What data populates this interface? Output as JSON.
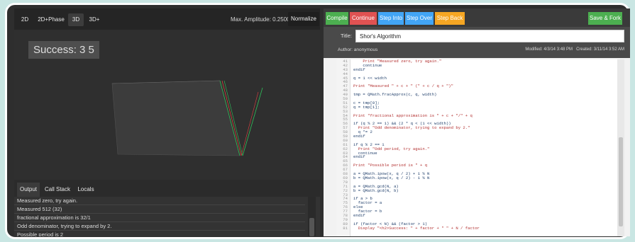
{
  "viz_tabs": [
    "2D",
    "2D+Phase",
    "3D",
    "3D+"
  ],
  "active_viz_tab": "3D",
  "max_amplitude": "Max. Amplitude: 0.250000",
  "normalize_label": "Normalize",
  "success_text": "Success: 3 5",
  "output_tabs": [
    "Output",
    "Call Stack",
    "Locals"
  ],
  "output_lines": [
    "Measured zero, try again.",
    "Measured 512 (32)",
    "fractional approximation is 32/1",
    "Odd denominator, trying to expand by 2.",
    "Possible period is 2"
  ],
  "toolbar": {
    "compile": "Compile",
    "continue": "Continue",
    "step_into": "Step Into",
    "step_over": "Step Over",
    "step_back": "Step Back",
    "save_fork": "Save & Fork"
  },
  "editor_header": {
    "title_label": "Title:",
    "title_value": "Shor's Algorithm",
    "author": "Author: anonymous",
    "modified": "Modified: 4/3/14 3:48 PM",
    "created": "Created: 3/11/14 3:52 AM"
  },
  "code_lines": [
    {
      "n": "41",
      "t": "    Print \"Measured zero, try again.\"",
      "s": true
    },
    {
      "n": "42",
      "t": "    continue",
      "s": false
    },
    {
      "n": "43",
      "t": "endif",
      "s": false
    },
    {
      "n": "44",
      "t": "",
      "s": false
    },
    {
      "n": "45",
      "t": "q = 1 << width",
      "s": false
    },
    {
      "n": "46",
      "t": "",
      "s": false
    },
    {
      "n": "47",
      "t": "Print \"Measured \" + c + \" (\" + c / q + \")\"",
      "s": true
    },
    {
      "n": "48",
      "t": "",
      "s": false
    },
    {
      "n": "49",
      "t": "tmp = QMath.fracApprox(c, q, width)",
      "s": false
    },
    {
      "n": "50",
      "t": "",
      "s": false
    },
    {
      "n": "51",
      "t": "c = tmp[0];",
      "s": false
    },
    {
      "n": "52",
      "t": "q = tmp[1];",
      "s": false
    },
    {
      "n": "53",
      "t": "",
      "s": false
    },
    {
      "n": "54",
      "t": "Print \"fractional approximation is \" + c + \"/\" + q",
      "s": true
    },
    {
      "n": "55",
      "t": "",
      "s": false
    },
    {
      "n": "56",
      "t": "if (q % 2 == 1) && (2 * q < (1 << width))",
      "s": false
    },
    {
      "n": "57",
      "t": "  Print \"Odd denominator, trying to expand by 2.\"",
      "s": true
    },
    {
      "n": "58",
      "t": "  q *= 2",
      "s": false
    },
    {
      "n": "59",
      "t": "endif",
      "s": false
    },
    {
      "n": "60",
      "t": "",
      "s": false
    },
    {
      "n": "61",
      "t": "if q % 2 == 1",
      "s": false
    },
    {
      "n": "62",
      "t": "  Print \"Odd period, try again.\"",
      "s": true
    },
    {
      "n": "63",
      "t": "  continue",
      "s": false
    },
    {
      "n": "64",
      "t": "endif",
      "s": false
    },
    {
      "n": "65",
      "t": "",
      "s": false
    },
    {
      "n": "66",
      "t": "Print \"Possible period is \" + q",
      "s": true
    },
    {
      "n": "67",
      "t": "",
      "s": false
    },
    {
      "n": "68",
      "t": "a = QMath.ipow(x, q / 2) + 1 % N",
      "s": false
    },
    {
      "n": "69",
      "t": "b = QMath.ipow(x, q / 2) - 1 % N",
      "s": false
    },
    {
      "n": "70",
      "t": "",
      "s": false
    },
    {
      "n": "71",
      "t": "a = QMath.gcd(N, a)",
      "s": false
    },
    {
      "n": "72",
      "t": "b = QMath.gcd(N, b)",
      "s": false
    },
    {
      "n": "73",
      "t": "",
      "s": false
    },
    {
      "n": "74",
      "t": "if a > b",
      "s": false
    },
    {
      "n": "75",
      "t": "  factor = a",
      "s": false
    },
    {
      "n": "76",
      "t": "else",
      "s": false
    },
    {
      "n": "77",
      "t": "  factor = b",
      "s": false
    },
    {
      "n": "78",
      "t": "endif",
      "s": false
    },
    {
      "n": "79",
      "t": "",
      "s": false
    },
    {
      "n": "80",
      "t": "if (factor < N) && (factor > 1)",
      "s": false
    },
    {
      "n": "81",
      "t": "  Display \"<h2>Success: \" + factor + \" \" + N / factor",
      "s": true
    }
  ],
  "colors": {
    "compile": "#4caf50",
    "continue": "#e05252",
    "step_into": "#42a5f5",
    "step_over": "#42a5f5",
    "step_back": "#f5a623",
    "save_fork": "#4caf50",
    "surface_green": "#2fbf5a",
    "surface_red": "#d94040"
  },
  "icons": []
}
